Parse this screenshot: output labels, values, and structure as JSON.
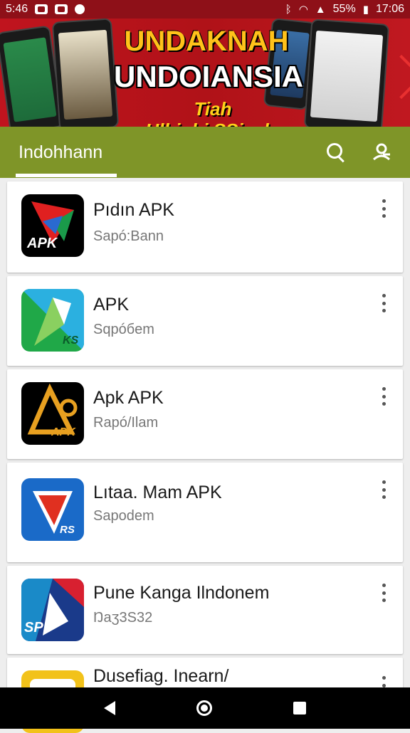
{
  "status_bar": {
    "left_text": "5:46",
    "battery": "55%",
    "time": "17:06"
  },
  "banner": {
    "title": "UNDAKNAH",
    "subtitle": "UNDOIANSIA",
    "tagline": "Tiah Ulbighi.SSisaln"
  },
  "app_bar": {
    "title": "Indohhann",
    "icons": [
      "search-icon",
      "profile-icon"
    ]
  },
  "apps": [
    {
      "title": "Pıdın APK",
      "subtitle": "Sapó:Bann",
      "icon_text": "APK"
    },
    {
      "title": "APK",
      "subtitle": "Sqpóбem",
      "icon_text": "KS"
    },
    {
      "title": "Apk APK",
      "subtitle": "Rapó/Ilam",
      "icon_text": "APK"
    },
    {
      "title": "Lıtaa. Mam APK",
      "subtitle": "Sapodem",
      "icon_text": "RS"
    },
    {
      "title": "Pune Kanga Ilndonem",
      "subtitle": "Ŋaʒ3S32",
      "icon_text": "SPIP"
    },
    {
      "title": "Dusefiag. Inearn/ ",
      "subtitle": "",
      "icon_text": ""
    }
  ],
  "colors": {
    "app_bar": "#7f9528",
    "banner": "#c0141e",
    "status_bar": "#8e1018"
  }
}
